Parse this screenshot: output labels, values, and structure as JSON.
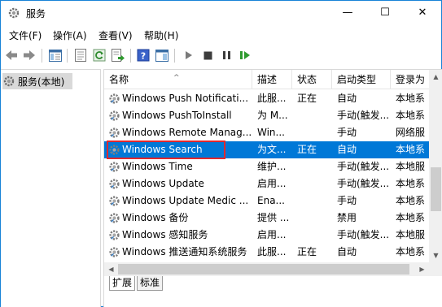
{
  "window": {
    "title": "服务",
    "controls": {
      "minimize": "—",
      "maximize": "☐",
      "close": "✕"
    }
  },
  "menu": [
    "文件(F)",
    "操作(A)",
    "查看(V)",
    "帮助(H)"
  ],
  "tree": {
    "root": "服务(本地)"
  },
  "columns": [
    "名称",
    "描述",
    "状态",
    "启动类型",
    "登录为"
  ],
  "rows": [
    {
      "name": "Windows Push Notificati...",
      "desc": "此服...",
      "status": "正在",
      "startup": "自动",
      "logon": "本地系"
    },
    {
      "name": "Windows PushToInstall",
      "desc": "为 M...",
      "status": "",
      "startup": "手动(触发...",
      "logon": "本地系"
    },
    {
      "name": "Windows Remote Manag...",
      "desc": "Win...",
      "status": "",
      "startup": "手动",
      "logon": "网络服"
    },
    {
      "name": "Windows Search",
      "desc": "为文...",
      "status": "正在",
      "startup": "自动",
      "logon": "本地系",
      "selected": true
    },
    {
      "name": "Windows Time",
      "desc": "维护...",
      "status": "",
      "startup": "手动(触发...",
      "logon": "本地服"
    },
    {
      "name": "Windows Update",
      "desc": "启用...",
      "status": "",
      "startup": "手动(触发...",
      "logon": "本地系"
    },
    {
      "name": "Windows Update Medic ...",
      "desc": "Ena...",
      "status": "",
      "startup": "手动",
      "logon": "本地系"
    },
    {
      "name": "Windows 备份",
      "desc": "提供 ...",
      "status": "",
      "startup": "禁用",
      "logon": "本地系"
    },
    {
      "name": "Windows 感知服务",
      "desc": "启用...",
      "status": "",
      "startup": "手动(触发...",
      "logon": "本地服"
    },
    {
      "name": "Windows 推送通知系统服务",
      "desc": "此服...",
      "status": "正在",
      "startup": "自动",
      "logon": "本地系"
    }
  ],
  "tabs": [
    "扩展",
    "标准"
  ],
  "colors": {
    "selection": "#0078d7",
    "highlight_border": "#e0282e",
    "window_border": "#1883d7"
  }
}
